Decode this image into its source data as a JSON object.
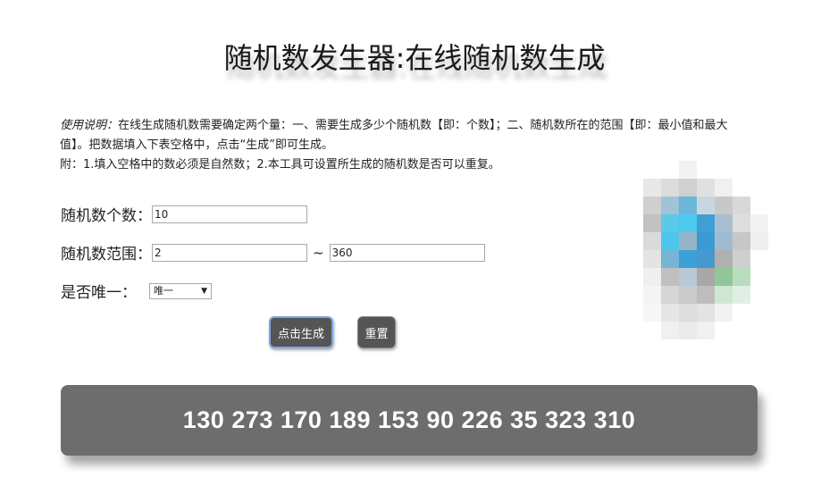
{
  "page": {
    "title": "随机数发生器:在线随机数生成"
  },
  "description": {
    "label": "使用说明：",
    "line1": "在线生成随机数需要确定两个量：一、需要生成多少个随机数【即：个数】；二、随机数所在的范围【即：最小值和最大值】。把数据填入下表空格中，点击“生成”即可生成。",
    "line2": "附：1.填入空格中的数必须是自然数；2.本工具可设置所生成的随机数是否可以重复。"
  },
  "form": {
    "count_label": "随机数个数：",
    "count_value": "10",
    "range_label": "随机数范围：",
    "range_min": "2",
    "range_separator": "~",
    "range_max": "360",
    "unique_label": "是否唯一：",
    "unique_selected": "唯一",
    "unique_arrow": "▼"
  },
  "buttons": {
    "generate": "点击生成",
    "reset": "重置"
  },
  "result": {
    "numbers": "130 273 170 189 153 90 226 35 323 310"
  },
  "colors": {
    "button_bg": "#555555",
    "result_bg": "#6d6d6d",
    "focus_border": "#7aa7e0"
  }
}
